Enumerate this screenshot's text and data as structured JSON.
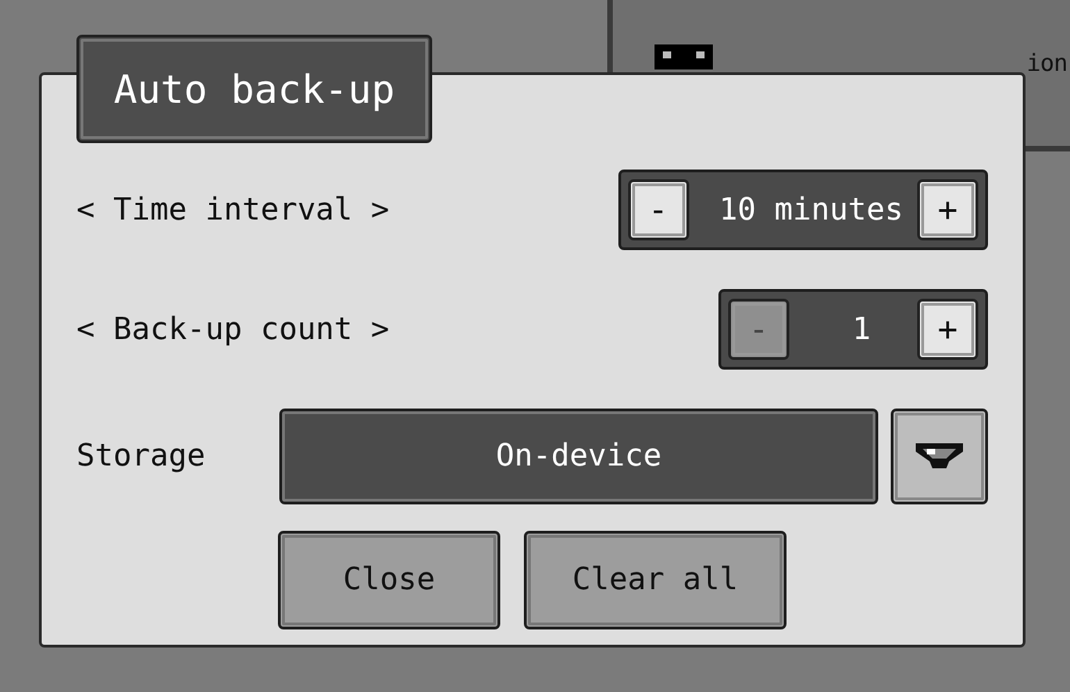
{
  "background_panel": {
    "label": "ion"
  },
  "dialog": {
    "title": "Auto back-up",
    "settings": [
      {
        "kind": "stepper",
        "label": "< Time interval >",
        "value": "10 minutes",
        "decrement": "-",
        "increment": "+",
        "decrement_disabled": false,
        "increment_disabled": false
      },
      {
        "kind": "stepper",
        "label": "< Back-up count >",
        "value": "1",
        "decrement": "-",
        "increment": "+",
        "decrement_disabled": true,
        "increment_disabled": false
      },
      {
        "kind": "select",
        "label": "Storage",
        "value": "On-device"
      }
    ],
    "buttons": [
      "Close",
      "Clear all"
    ]
  }
}
